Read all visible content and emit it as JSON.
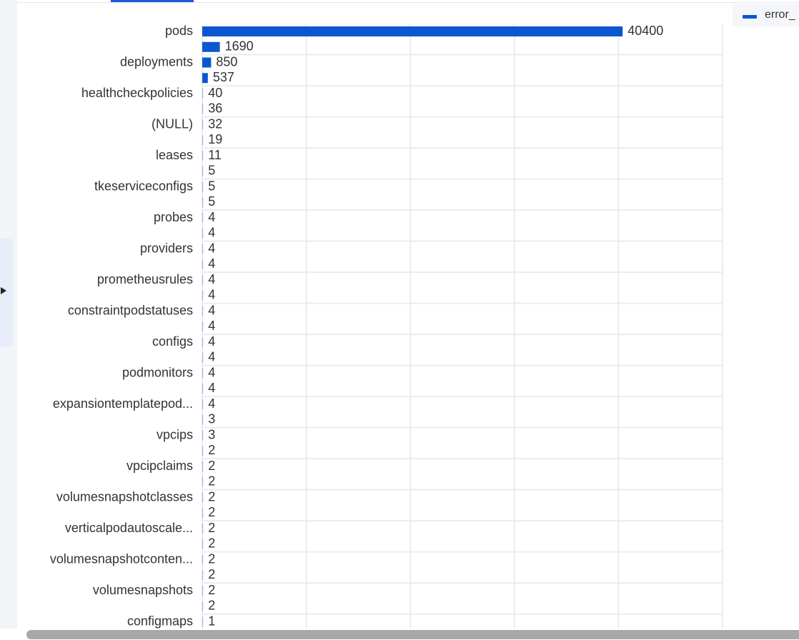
{
  "legend": {
    "series_name": "error_"
  },
  "colors": {
    "bar": "#0b57d0",
    "grid": "#e9ecf0",
    "axis_text": "#333333"
  },
  "icons": {
    "collapse": "caret-right-icon"
  },
  "chart_data": {
    "type": "bar",
    "orientation": "horizontal",
    "legend_position": "top-right",
    "grid": true,
    "xlim": [
      0,
      50000
    ],
    "categories": [
      "pods",
      "deployments",
      "healthcheckpolicies",
      "(NULL)",
      "leases",
      "tkeserviceconfigs",
      "probes",
      "providers",
      "prometheusrules",
      "constraintpodstatuses",
      "configs",
      "podmonitors",
      "expansiontemplatepod...",
      "vpcips",
      "vpcipclaims",
      "volumesnapshotclasses",
      "verticalpodautoscale...",
      "volumesnapshotconten...",
      "volumesnapshots",
      "configmaps"
    ],
    "series": [
      {
        "name": "error_",
        "values": [
          40400,
          1690,
          850,
          537,
          40,
          36,
          32,
          19,
          11,
          5,
          5,
          5,
          4,
          4,
          4,
          4,
          4,
          4,
          4,
          4,
          4,
          4,
          4,
          4,
          4,
          3,
          3,
          2,
          2,
          2,
          2,
          2,
          2,
          2,
          2,
          2,
          2,
          2,
          1
        ]
      }
    ]
  }
}
